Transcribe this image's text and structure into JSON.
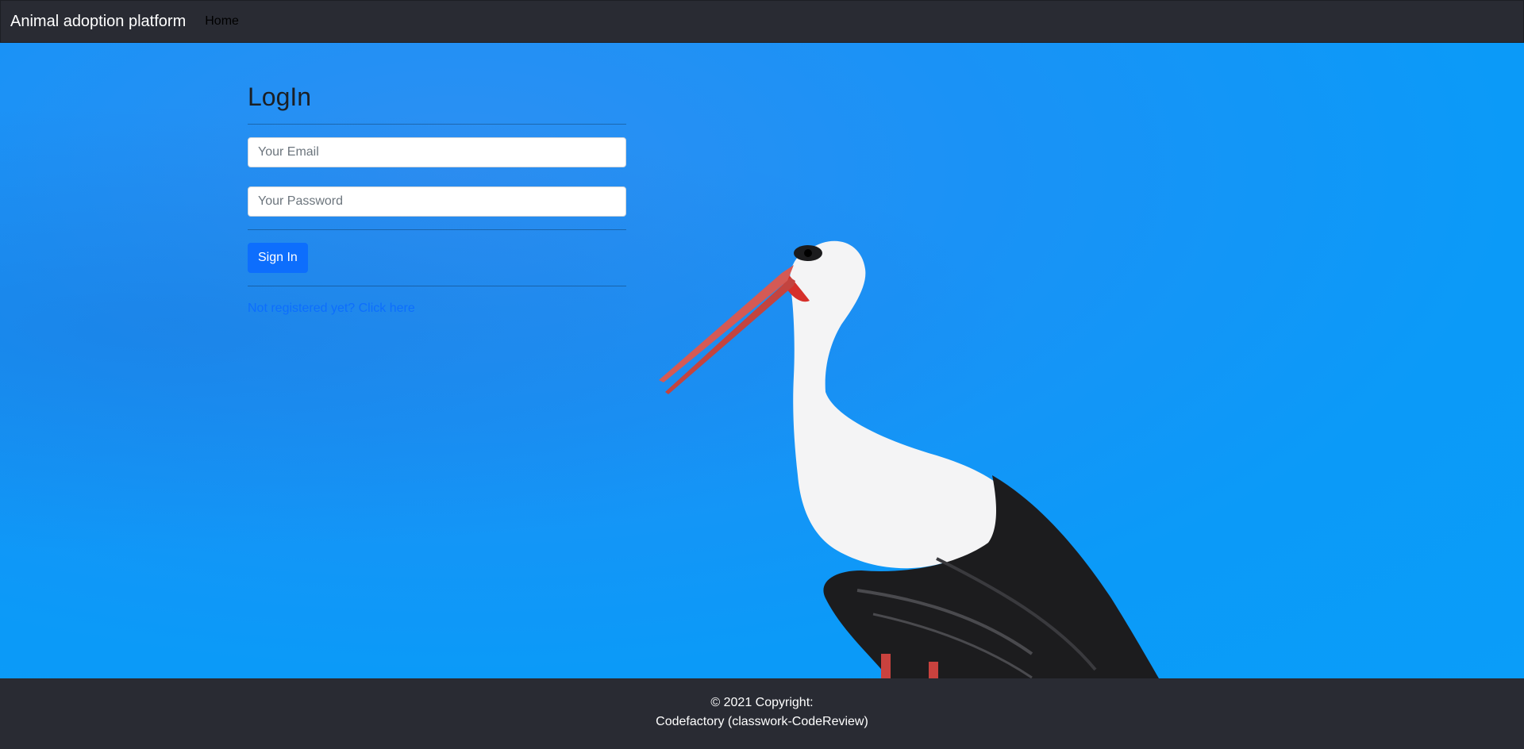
{
  "navbar": {
    "brand": "Animal adoption platform",
    "links": [
      {
        "label": "Home"
      }
    ]
  },
  "login": {
    "title": "LogIn",
    "email_placeholder": "Your Email",
    "password_placeholder": "Your Password",
    "submit_label": "Sign In",
    "register_link": "Not registered yet? Click here"
  },
  "footer": {
    "line1": "© 2021 Copyright:",
    "line2": "Codefactory (classwork-CodeReview)"
  },
  "colors": {
    "navbar_bg": "#292b33",
    "sky_blue": "#1593f5",
    "primary": "#0d6efd"
  },
  "background": {
    "image_subject": "white stork against blue sky"
  }
}
